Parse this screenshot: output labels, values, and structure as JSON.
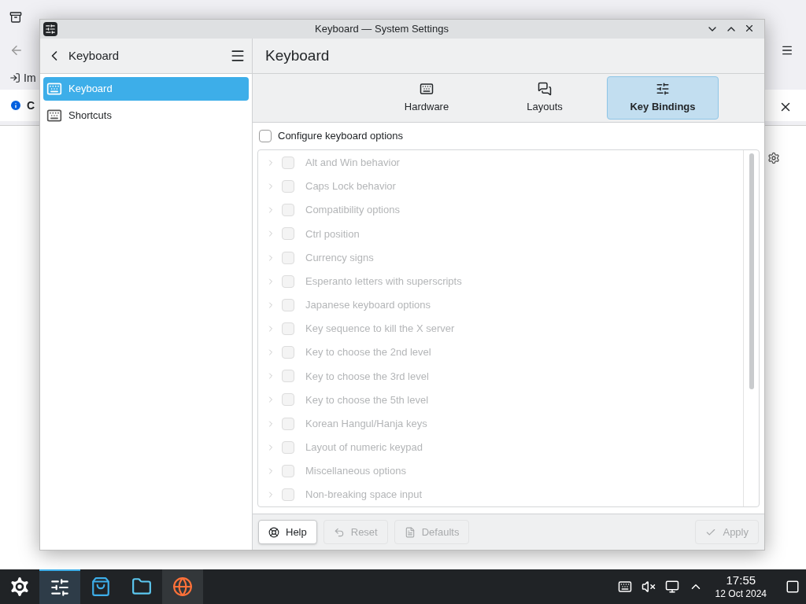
{
  "background_browser": {
    "import_label": "Im",
    "notice_initial": "C"
  },
  "window": {
    "title": "Keyboard — System Settings"
  },
  "sidebar": {
    "title": "Keyboard",
    "items": [
      {
        "label": "Keyboard",
        "selected": true
      },
      {
        "label": "Shortcuts",
        "selected": false
      }
    ]
  },
  "page_title": "Keyboard",
  "tabs": [
    {
      "label": "Hardware",
      "kind": "hardware",
      "selected": false
    },
    {
      "label": "Layouts",
      "kind": "layouts",
      "selected": false
    },
    {
      "label": "Key Bindings",
      "kind": "bindings",
      "selected": true
    }
  ],
  "configure": {
    "label": "Configure keyboard options",
    "checked": false
  },
  "options": {
    "disabled": true,
    "items": [
      {
        "label": "Alt and Win behavior",
        "checked": false,
        "expanded": false
      },
      {
        "label": "Caps Lock behavior",
        "checked": false,
        "expanded": false
      },
      {
        "label": "Compatibility options",
        "checked": false,
        "expanded": false
      },
      {
        "label": "Ctrl position",
        "checked": false,
        "expanded": false
      },
      {
        "label": "Currency signs",
        "checked": false,
        "expanded": false
      },
      {
        "label": "Esperanto letters with superscripts",
        "checked": false,
        "expanded": false
      },
      {
        "label": "Japanese keyboard options",
        "checked": false,
        "expanded": false
      },
      {
        "label": "Key sequence to kill the X server",
        "checked": false,
        "expanded": false
      },
      {
        "label": "Key to choose the 2nd level",
        "checked": false,
        "expanded": false
      },
      {
        "label": "Key to choose the 3rd level",
        "checked": false,
        "expanded": false
      },
      {
        "label": "Key to choose the 5th level",
        "checked": false,
        "expanded": false
      },
      {
        "label": "Korean Hangul/Hanja keys",
        "checked": false,
        "expanded": false
      },
      {
        "label": "Layout of numeric keypad",
        "checked": false,
        "expanded": false
      },
      {
        "label": "Miscellaneous options",
        "checked": false,
        "expanded": false
      },
      {
        "label": "Non-breaking space input",
        "checked": false,
        "expanded": false
      }
    ]
  },
  "footer": [
    {
      "label": "Help",
      "kind": "help",
      "disabled": false
    },
    {
      "label": "Reset",
      "kind": "reset",
      "disabled": true
    },
    {
      "label": "Defaults",
      "kind": "defaults",
      "disabled": true
    },
    {
      "label": "Apply",
      "kind": "apply",
      "disabled": true
    }
  ],
  "taskbar": {
    "tasks": [
      {
        "kind": "settings",
        "selected": true
      },
      {
        "kind": "store",
        "selected": false
      },
      {
        "kind": "files",
        "selected": false
      },
      {
        "kind": "browser",
        "selected": false
      }
    ],
    "time": "17:55",
    "date": "12 Oct 2024"
  }
}
